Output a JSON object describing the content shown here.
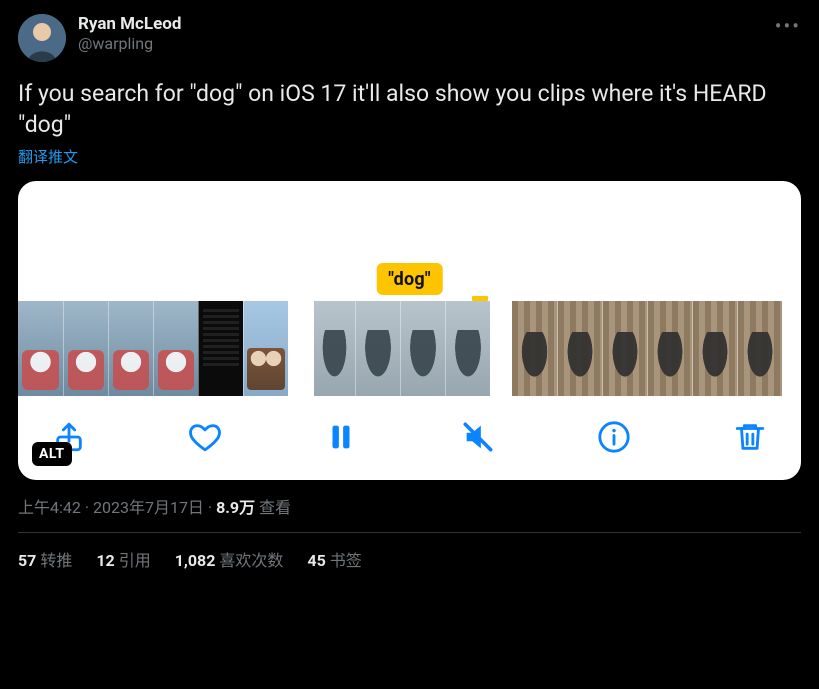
{
  "author": {
    "display_name": "Ryan McLeod",
    "handle": "@warpling"
  },
  "tweet_text": "If you search for \"dog\" on iOS 17 it'll also show you clips where it's HEARD \"dog\"",
  "translate_label": "翻译推文",
  "media": {
    "caption_badge": "\"dog\"",
    "alt_badge": "ALT",
    "toolbar_icons": [
      "share",
      "heart",
      "pause",
      "mute",
      "info",
      "trash"
    ]
  },
  "meta": {
    "time": "上午4:42",
    "date": "2023年7月17日",
    "views_count": "8.9万",
    "views_label": "查看"
  },
  "stats": {
    "retweets": {
      "count": "57",
      "label": "转推"
    },
    "quotes": {
      "count": "12",
      "label": "引用"
    },
    "likes": {
      "count": "1,082",
      "label": "喜欢次数"
    },
    "bookmarks": {
      "count": "45",
      "label": "书签"
    }
  }
}
